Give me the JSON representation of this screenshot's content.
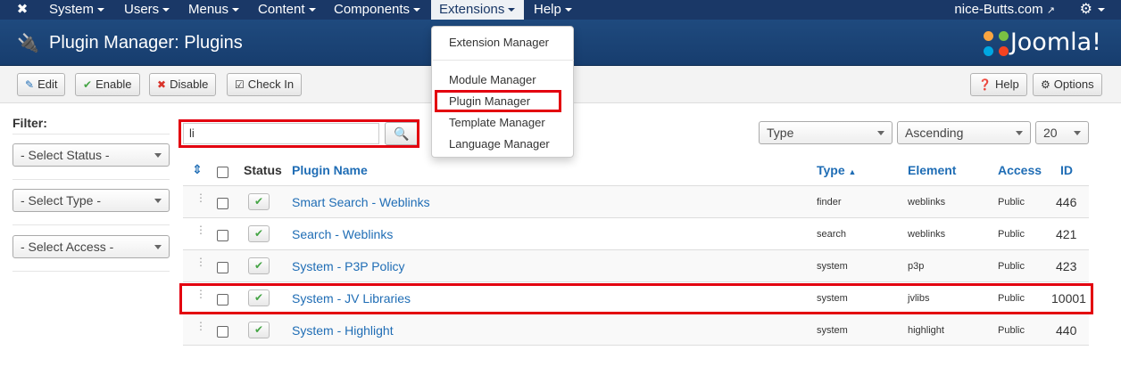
{
  "navbar": {
    "menu": [
      {
        "label": "System"
      },
      {
        "label": "Users"
      },
      {
        "label": "Menus"
      },
      {
        "label": "Content"
      },
      {
        "label": "Components"
      },
      {
        "label": "Extensions"
      },
      {
        "label": "Help"
      }
    ],
    "site_link": "nice-Butts.com"
  },
  "header": {
    "title": "Plugin Manager: Plugins",
    "brand": "Joomla!"
  },
  "toolbar": {
    "edit": "Edit",
    "enable": "Enable",
    "disable": "Disable",
    "checkin": "Check In",
    "help": "Help",
    "options": "Options"
  },
  "sidebar": {
    "filter_title": "Filter:",
    "status": "- Select Status -",
    "type": "- Select Type -",
    "access": "- Select Access -"
  },
  "search": {
    "value": "li"
  },
  "list_controls": {
    "sort_field": "Type",
    "sort_order": "Ascending",
    "limit": "20"
  },
  "table": {
    "headers": {
      "status": "Status",
      "name": "Plugin Name",
      "type": "Type",
      "element": "Element",
      "access": "Access",
      "id": "ID"
    },
    "rows": [
      {
        "name": "Smart Search - Weblinks",
        "type": "finder",
        "element": "weblinks",
        "access": "Public",
        "id": "446"
      },
      {
        "name": "Search - Weblinks",
        "type": "search",
        "element": "weblinks",
        "access": "Public",
        "id": "421"
      },
      {
        "name": "System - P3P Policy",
        "type": "system",
        "element": "p3p",
        "access": "Public",
        "id": "423"
      },
      {
        "name": "System - JV Libraries",
        "type": "system",
        "element": "jvlibs",
        "access": "Public",
        "id": "10001"
      },
      {
        "name": "System - Highlight",
        "type": "system",
        "element": "highlight",
        "access": "Public",
        "id": "440"
      }
    ]
  },
  "dropdown": {
    "items": [
      {
        "label": "Extension Manager"
      },
      {
        "label": "Module Manager"
      },
      {
        "label": "Plugin Manager"
      },
      {
        "label": "Template Manager"
      },
      {
        "label": "Language Manager"
      }
    ]
  },
  "colors": {
    "navbar": "#1a3867",
    "link": "#1f6db5",
    "highlight_box": "#e3000f",
    "status_ok": "#46a546"
  }
}
